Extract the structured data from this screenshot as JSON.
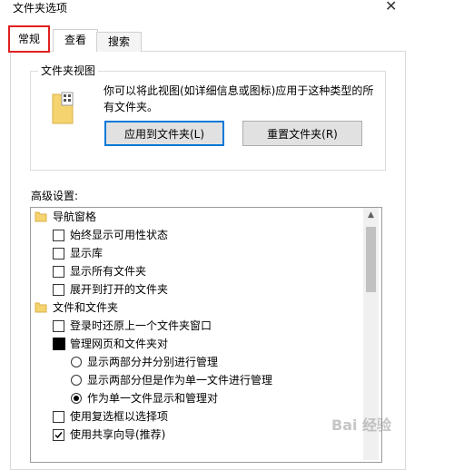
{
  "window": {
    "title": "文件夹选项",
    "close_icon": "close-icon"
  },
  "tabs": [
    {
      "label": "常规",
      "highlighted": true
    },
    {
      "label": "查看",
      "selected": true
    },
    {
      "label": "搜索"
    }
  ],
  "folder_views": {
    "group_title": "文件夹视图",
    "description": "你可以将此视图(如详细信息或图标)应用于这种类型的所有文件夹。",
    "apply_button": "应用到文件夹(L)",
    "reset_button": "重置文件夹(R)"
  },
  "advanced": {
    "label": "高级设置:",
    "items": [
      {
        "type": "folder",
        "label": "导航窗格"
      },
      {
        "type": "checkbox",
        "checked": false,
        "label": "始终显示可用性状态"
      },
      {
        "type": "checkbox",
        "checked": false,
        "label": "显示库"
      },
      {
        "type": "checkbox",
        "checked": false,
        "label": "显示所有文件夹"
      },
      {
        "type": "checkbox",
        "checked": false,
        "label": "展开到打开的文件夹"
      },
      {
        "type": "folder",
        "label": "文件和文件夹"
      },
      {
        "type": "checkbox",
        "checked": false,
        "label": "登录时还原上一个文件夹窗口"
      },
      {
        "type": "group",
        "label": "管理网页和文件夹对"
      },
      {
        "type": "radio",
        "checked": false,
        "label": "显示两部分并分别进行管理"
      },
      {
        "type": "radio",
        "checked": false,
        "label": "显示两部分但是作为单一文件进行管理"
      },
      {
        "type": "radio",
        "checked": true,
        "label": "作为单一文件显示和管理对"
      },
      {
        "type": "checkbox",
        "checked": false,
        "label": "使用复选框以选择项"
      },
      {
        "type": "checkbox",
        "checked": true,
        "label": "使用共享向导(推荐)"
      }
    ]
  },
  "watermark": "Bai 经验",
  "colors": {
    "highlight_border": "#e02020",
    "accent": "#0078d7"
  }
}
